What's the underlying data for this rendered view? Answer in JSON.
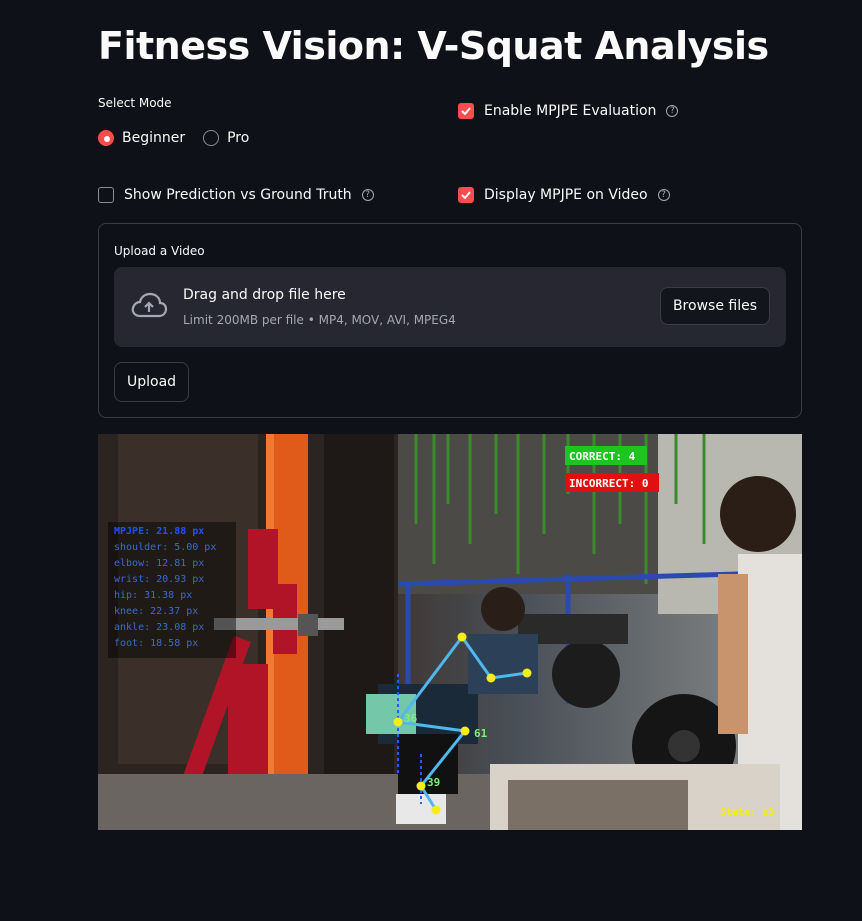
{
  "page": {
    "title": "Fitness Vision: V-Squat Analysis"
  },
  "mode": {
    "label": "Select Mode",
    "options": [
      {
        "label": "Beginner",
        "selected": true
      },
      {
        "label": "Pro",
        "selected": false
      }
    ]
  },
  "options": {
    "mpjpe_eval": {
      "label": "Enable MPJPE Evaluation",
      "checked": true
    },
    "pred_vs_gt": {
      "label": "Show Prediction vs Ground Truth",
      "checked": false
    },
    "display_mpjpe": {
      "label": "Display MPJPE on Video",
      "checked": true
    },
    "help_glyph": "?"
  },
  "upload": {
    "label": "Upload a Video",
    "drop_title": "Drag and drop file here",
    "drop_limit": "Limit 200MB per file • MP4, MOV, AVI, MPEG4",
    "browse_label": "Browse files",
    "upload_label": "Upload"
  },
  "video": {
    "correct": "CORRECT: 4",
    "incorrect": "INCORRECT: 0",
    "mpjpe_lines": [
      "MPJPE: 21.88 px",
      "shoulder: 5.00 px",
      "elbow: 12.81 px",
      "wrist: 20.93 px",
      "hip: 31.38 px",
      "knee: 22.37 px",
      "ankle: 23.08 px",
      "foot: 18.58 px"
    ],
    "angles": [
      "36",
      "61",
      "39"
    ],
    "state": "State: s3",
    "colors": {
      "correct": "#1ec51e",
      "incorrect": "#e01010",
      "skeleton": "#4fb8ee",
      "joint": "#f5ec1a",
      "angle_text": "#7cf07c",
      "state_text": "#f5ec1a"
    }
  }
}
